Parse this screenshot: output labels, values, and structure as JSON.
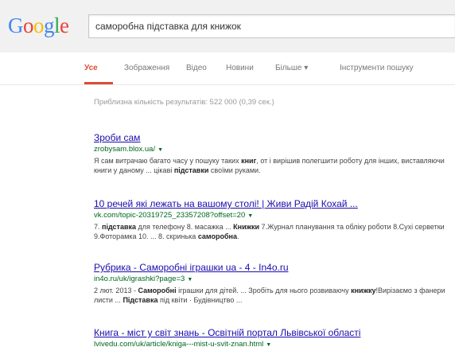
{
  "header": {
    "logo": "Google",
    "search_query": "саморобна підставка для книжок"
  },
  "tabs": [
    {
      "label": "Усе",
      "active": true
    },
    {
      "label": "Зображення",
      "active": false
    },
    {
      "label": "Відео",
      "active": false
    },
    {
      "label": "Новини",
      "active": false
    },
    {
      "label": "Більше ▾",
      "active": false
    },
    {
      "label": "Інструменти пошуку",
      "active": false
    }
  ],
  "stats": "Приблизна кількість результатів: 522 000 (0,39 сек.)",
  "results": [
    {
      "title": "Зроби сам",
      "url": "zrobysam.blox.ua/",
      "snippet": "Я сам витрачаю багато часу у пошуку таких <b>книг</b>, от і вирішив полегшити роботу для інших, виставляючи книги у даному ... цікаві <b>підставки</b> своїми руками."
    },
    {
      "title": "10 речей які лежать на вашому столі! | Живи Радій Кохай ...",
      "url": "vk.com/topic-20319725_23357208?offset=20",
      "snippet": "7. <b>підставка</b> для телефону 8. масажка ... <b>Книжки</b> 7.Журнал планування та обліку роботи 8.Сухі серветки 9.Фоторамка 10. ... 8. скринька <b>саморобна</b>."
    },
    {
      "title": "Рубрика - Саморобні іграшки ua - 4 - In4o.ru",
      "url": "in4o.ru/uk/igrashki?page=3",
      "snippet": "2 лют. 2013 - <b>Саморобні</b> іграшки для дітей. ... Зробіть для нього розвиваючу <b>книжку</b>!Вирізаємо з фанери листи ... <b>Підставка</b> під квіти · Будівництво ..."
    },
    {
      "title": "Книга - міст у світ знань - Освітній портал Львівської області",
      "url": "lvivedu.com/uk/article/kniga---mist-u-svit-znan.html",
      "snippet": ""
    }
  ],
  "colors": {
    "header_bg": "#f1f1f1",
    "active_tab": "#dd4b39",
    "link": "#1a0dab",
    "url": "#006621"
  }
}
